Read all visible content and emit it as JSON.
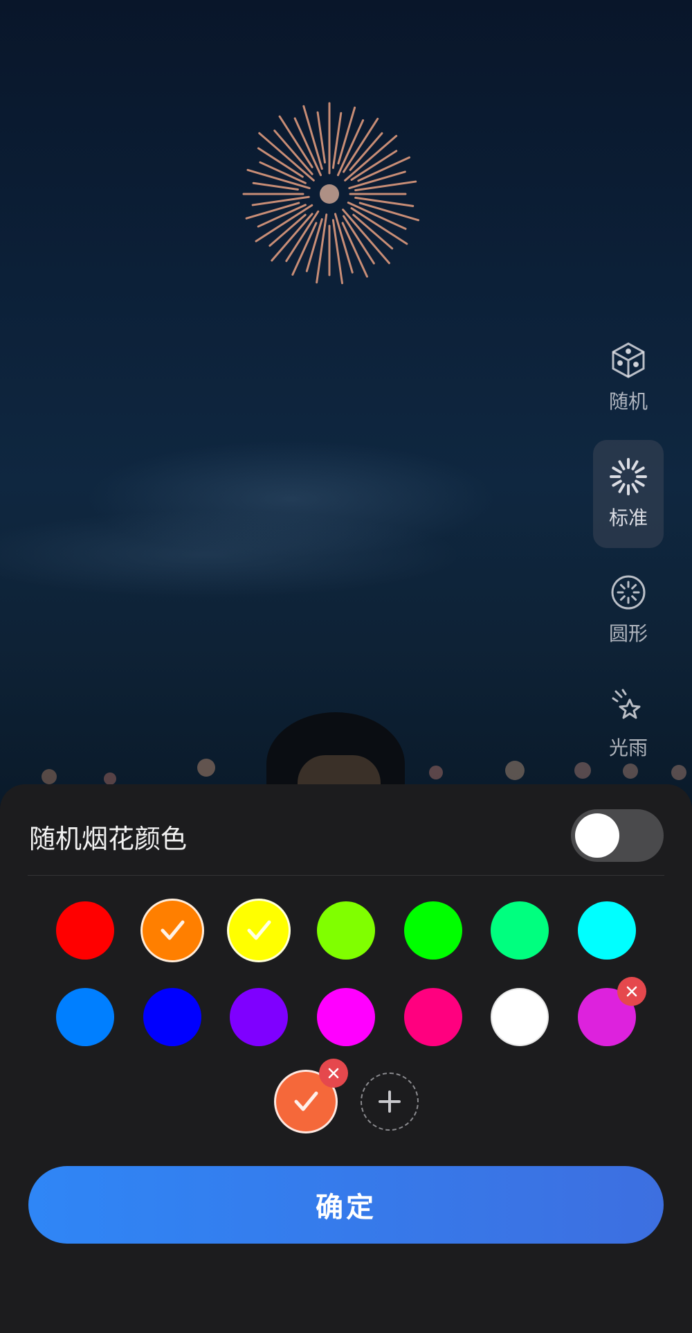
{
  "modes": [
    {
      "label": "随机",
      "icon": "dice-icon",
      "active": false
    },
    {
      "label": "标准",
      "icon": "burst-icon",
      "active": true
    },
    {
      "label": "圆形",
      "icon": "circle-burst-icon",
      "active": false
    },
    {
      "label": "光雨",
      "icon": "star-rain-icon",
      "active": false
    }
  ],
  "panel": {
    "title": "随机烟花颜色",
    "random_toggle_on": false,
    "palette": [
      {
        "color": "#ff0000",
        "selected": false
      },
      {
        "color": "#ff7f00",
        "selected": true
      },
      {
        "color": "#ffff00",
        "selected": true
      },
      {
        "color": "#80ff00",
        "selected": false
      },
      {
        "color": "#00ff00",
        "selected": false
      },
      {
        "color": "#00ff7f",
        "selected": false
      },
      {
        "color": "#00ffff",
        "selected": false
      },
      {
        "color": "#007fff",
        "selected": false
      },
      {
        "color": "#0000ff",
        "selected": false
      },
      {
        "color": "#7f00ff",
        "selected": false
      },
      {
        "color": "#ff00ff",
        "selected": false
      },
      {
        "color": "#ff007f",
        "selected": false
      },
      {
        "color": "#ffffff",
        "selected": false
      },
      {
        "color": "#dd22dd",
        "selected": false,
        "removable": true
      }
    ],
    "custom_colors": [
      {
        "color": "#f5683a",
        "selected": true,
        "removable": true
      }
    ],
    "confirm_label": "确定"
  },
  "colors": {
    "sheet_bg": "#1c1c1e",
    "accent": "#2f86f6",
    "remove_badge": "#e5484d"
  }
}
